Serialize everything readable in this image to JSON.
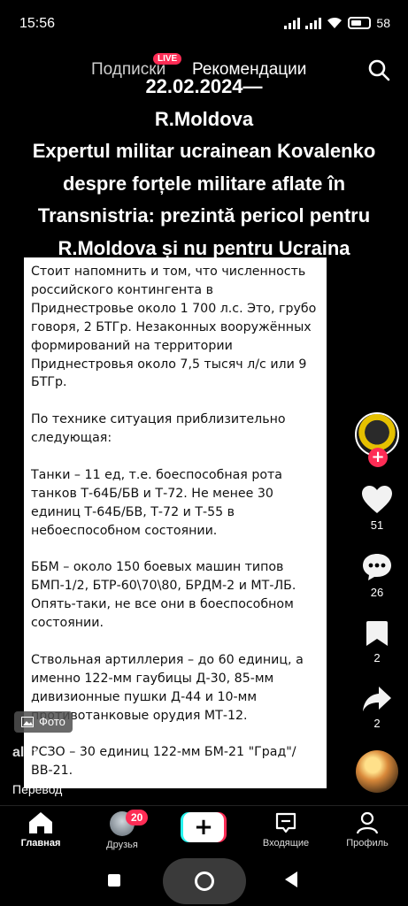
{
  "status_bar": {
    "time": "15:56",
    "battery": "58"
  },
  "top_tabs": {
    "following": "Подписки",
    "live_badge": "LIVE",
    "recommended": "Рекомендации"
  },
  "headline": {
    "line1": "22.02.2024—",
    "line2": "R.Moldova",
    "line3": "Expertul militar ucrainean Kovalenko",
    "line4": "despre forțele militare aflate în",
    "line5": "Transnistria: prezintă pericol pentru",
    "line6": "R.Moldova și nu pentru Ucraina"
  },
  "document": {
    "paragraphs": [
      "Стоит напомнить и том, что численность российского контингента в Приднестровье около 1 700 л.с. Это, грубо говоря, 2 БТГр. Незаконных вооружённых формирований на территории Приднестровья около 7,5 тысяч л/с или 9 БТГр.",
      "По технике ситуация приблизительно следующая:",
      "Танки – 11 ед, т.е. боеспособная рота танков Т-64Б/БВ и Т-72. Не менее 30 единиц Т-64Б/БВ, Т-72 и Т-55 в небоеспособном состоянии.",
      "ББМ – около 150 боевых машин типов БМП-1/2, БТР-60\\70\\80, БРДМ-2 и МТ-ЛБ. Опять-таки, не все они в боеспособном состоянии.",
      "Ствольная артиллерия – до 60 единиц, а именно 122-мм гаубицы Д-30, 85-мм дивизионные пушки Д-44 и 10-мм противотанковые орудия МТ-12.",
      "РСЗО – 30 единиц 122-мм БМ-21 \"Град\"/ ВВ-21."
    ]
  },
  "actions": {
    "likes": "51",
    "comments": "26",
    "saves": "2",
    "shares": "2"
  },
  "photo_badge": "Фото",
  "author": "alex",
  "translate_label": "Перевод",
  "bottom_nav": {
    "home": "Главная",
    "friends": "Друзья",
    "friends_badge": "20",
    "create": "+",
    "inbox": "Входящие",
    "profile": "Профиль"
  }
}
